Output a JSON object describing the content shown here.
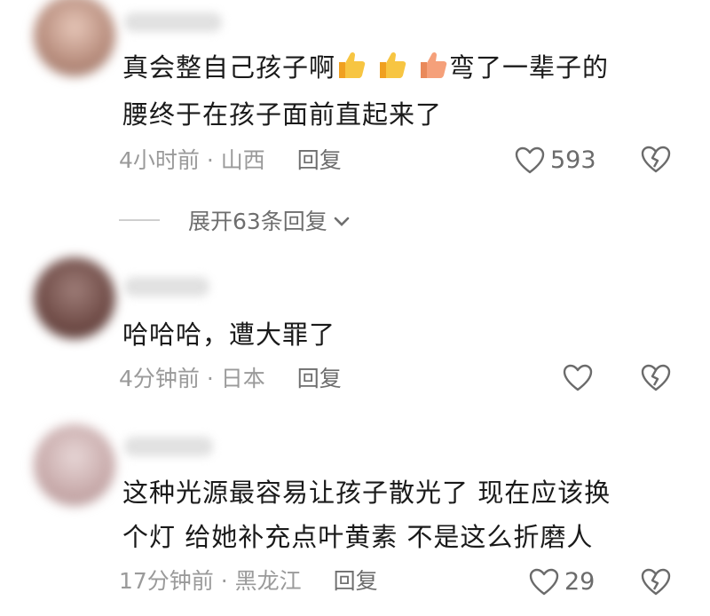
{
  "comments": [
    {
      "line1_a": "真会整自己孩子啊",
      "line1_b": "弯了一辈子的",
      "line2": "腰终于在孩子面前直起来了",
      "time": "4小时前",
      "location": "山西",
      "reply": "回复",
      "likes": "593",
      "expand": "展开63条回复",
      "avatar_color": "#b58a7a"
    },
    {
      "line1": "哈哈哈，遭大罪了",
      "time": "4分钟前",
      "location": "日本",
      "reply": "回复",
      "likes": "",
      "avatar_color": "#6e4a45"
    },
    {
      "line1": "这种光源最容易让孩子散光了 现在应该换",
      "line2": "个灯 给她补充点叶黄素 不是这么折磨人",
      "time": "17分钟前",
      "location": "黑龙江",
      "reply": "回复",
      "likes": "29",
      "avatar_color": "#c7a9a9"
    }
  ],
  "separator": " · ",
  "icons": {
    "like": "heart-outline-icon",
    "dislike": "broken-heart-icon",
    "thumbs": "thumbs-up-emoji",
    "chevron": "chevron-down-icon"
  },
  "colors": {
    "text": "#1a1a1a",
    "meta": "#9a9a9a",
    "thumb": "#f5b731"
  }
}
